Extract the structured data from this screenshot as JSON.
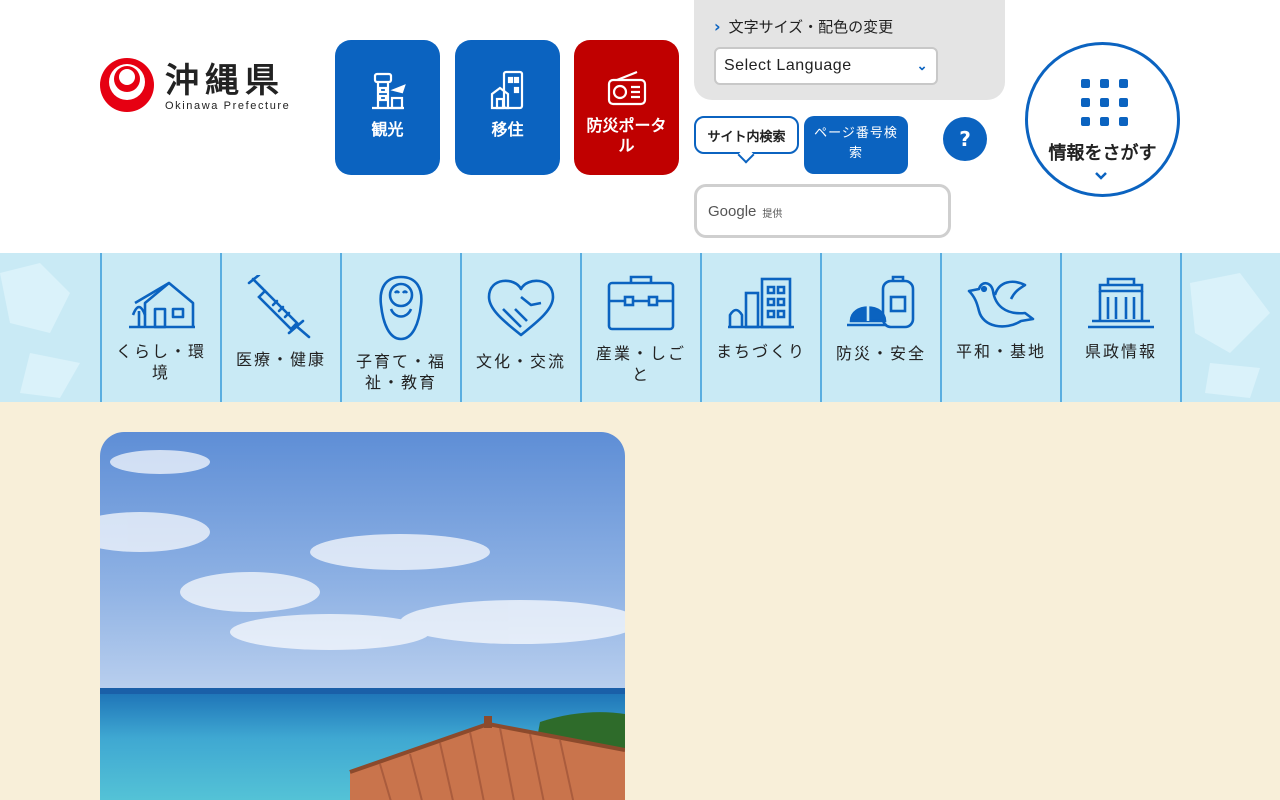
{
  "header": {
    "logo": {
      "name_ja": "沖縄県",
      "name_en": "Okinawa Prefecture"
    },
    "quick_buttons": [
      {
        "label": "観光",
        "icon": "airport-tower-icon"
      },
      {
        "label": "移住",
        "icon": "buildings-icon"
      },
      {
        "label": "防災ポータル",
        "icon": "radio-icon"
      }
    ],
    "utility": {
      "text_size_label": "文字サイズ・配色の変更",
      "language_select": {
        "value": "Select Language"
      }
    },
    "search": {
      "tab_site": "サイト内検索",
      "tab_page_number": "ページ番号検索",
      "help": "?",
      "provider_brand": "Google",
      "provider_suffix": "提供"
    },
    "find_info": {
      "label": "情報をさがす",
      "icon": "grid-dots-icon"
    }
  },
  "nav": {
    "items": [
      {
        "label": "くらし・環境",
        "icon": "house-icon"
      },
      {
        "label": "医療・健康",
        "icon": "syringe-icon"
      },
      {
        "label": "子育て・福祉・教育",
        "icon": "baby-icon"
      },
      {
        "label": "文化・交流",
        "icon": "heart-handshake-icon"
      },
      {
        "label": "産業・しごと",
        "icon": "briefcase-icon"
      },
      {
        "label": "まちづくり",
        "icon": "city-icon"
      },
      {
        "label": "防災・安全",
        "icon": "helmet-backpack-icon"
      },
      {
        "label": "平和・基地",
        "icon": "dove-icon"
      },
      {
        "label": "県政情報",
        "icon": "government-building-icon"
      }
    ]
  },
  "colors": {
    "brand_blue": "#0b63c0",
    "alert_red": "#c00000",
    "nav_bg": "#c9eaf5",
    "page_bg": "#f8efd9"
  }
}
